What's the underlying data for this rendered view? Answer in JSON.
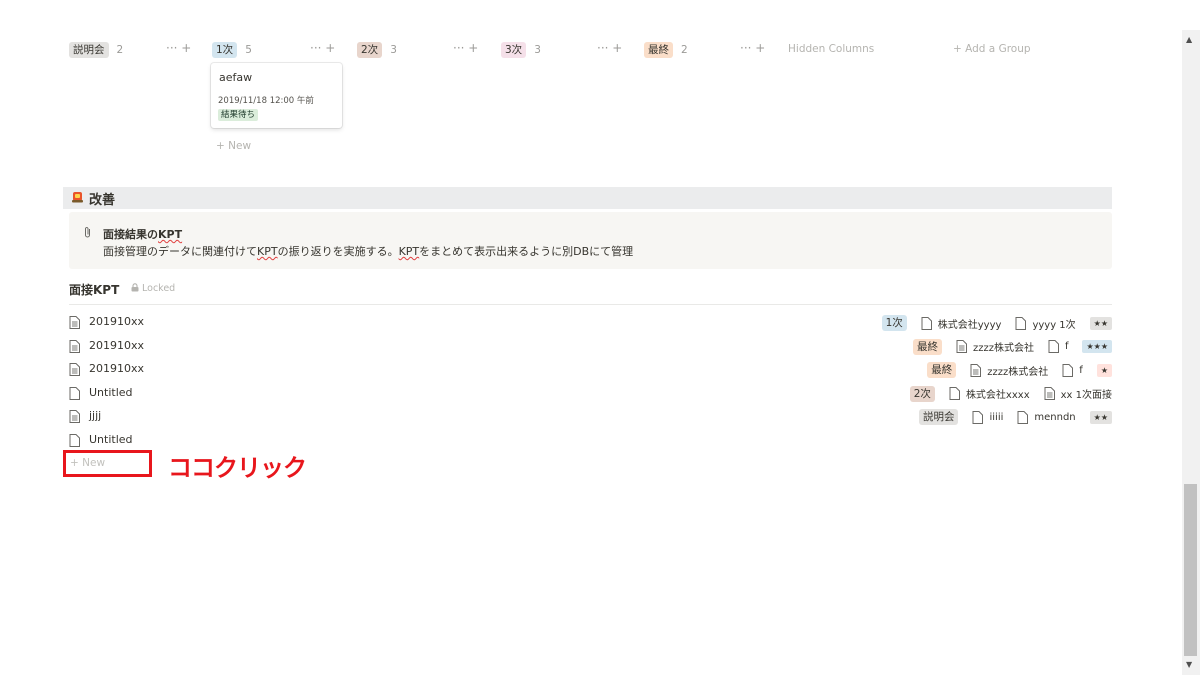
{
  "board": {
    "groups": [
      {
        "label": "説明会",
        "count": "2",
        "color": "#e3e2e0"
      },
      {
        "label": "1次",
        "count": "5",
        "color": "#d3e5ef"
      },
      {
        "label": "2次",
        "count": "3",
        "color": "#e8d5cc"
      },
      {
        "label": "3次",
        "count": "3",
        "color": "#f5e0e9"
      },
      {
        "label": "最終",
        "count": "2",
        "color": "#fadec9"
      }
    ],
    "controls": "··· +",
    "hidden_columns": "Hidden Columns",
    "add_group": "+ Add a Group",
    "card": {
      "title": "aefaw",
      "date": "2019/11/18 12:00 午前",
      "status": "結果待ち"
    },
    "new_label": "+ New"
  },
  "section": {
    "icon": "lamp-icon",
    "title": "改善"
  },
  "callout": {
    "icon": "paperclip-icon",
    "title_pre": "面接結果の",
    "title_kpt": "KPT",
    "desc_a": "面接管理のデータに関連付けて",
    "desc_kpt1": "KPT",
    "desc_b": "の振り返りを実施する。",
    "desc_kpt2": "KPT",
    "desc_c": "をまとめて表示出来るように別DBにて管理"
  },
  "database": {
    "title": "面接KPT",
    "locked": "Locked",
    "rows": [
      {
        "name": "201910xx",
        "doc_filled": true,
        "stage": "1次",
        "stage_color": "#d3e5ef",
        "company": "株式会社yyyy",
        "company_filled": false,
        "interview": "yyyy 1次",
        "interview_filled": false,
        "rating": "★★",
        "rating_color": "#e3e2e0"
      },
      {
        "name": "201910xx",
        "doc_filled": true,
        "stage": "最終",
        "stage_color": "#fadec9",
        "company": "zzzz株式会社",
        "company_filled": true,
        "interview": "f",
        "interview_filled": false,
        "rating": "★★★",
        "rating_color": "#d3e5ef"
      },
      {
        "name": "201910xx",
        "doc_filled": true,
        "stage": "最終",
        "stage_color": "#fadec9",
        "company": "zzzz株式会社",
        "company_filled": true,
        "interview": "f",
        "interview_filled": false,
        "rating": "★",
        "rating_color": "#ffe2dd"
      },
      {
        "name": "Untitled",
        "doc_filled": false,
        "stage": "2次",
        "stage_color": "#e8d5cc",
        "company": "株式会社xxxx",
        "company_filled": false,
        "interview": "xx 1次面接",
        "interview_filled": true,
        "rating": "",
        "rating_color": ""
      },
      {
        "name": "jjjj",
        "doc_filled": true,
        "stage": "説明会",
        "stage_color": "#e3e2e0",
        "company": "iiiii",
        "company_filled": false,
        "interview": "menndn",
        "interview_filled": false,
        "rating": "★★",
        "rating_color": "#e3e2e0"
      },
      {
        "name": "Untitled",
        "doc_filled": false,
        "stage": "",
        "stage_color": "",
        "company": "",
        "company_filled": false,
        "interview": "",
        "interview_filled": false,
        "rating": "",
        "rating_color": ""
      }
    ],
    "new_label": "+ New"
  },
  "annotation": {
    "label": "ココクリック",
    "color": "#e8161c"
  }
}
